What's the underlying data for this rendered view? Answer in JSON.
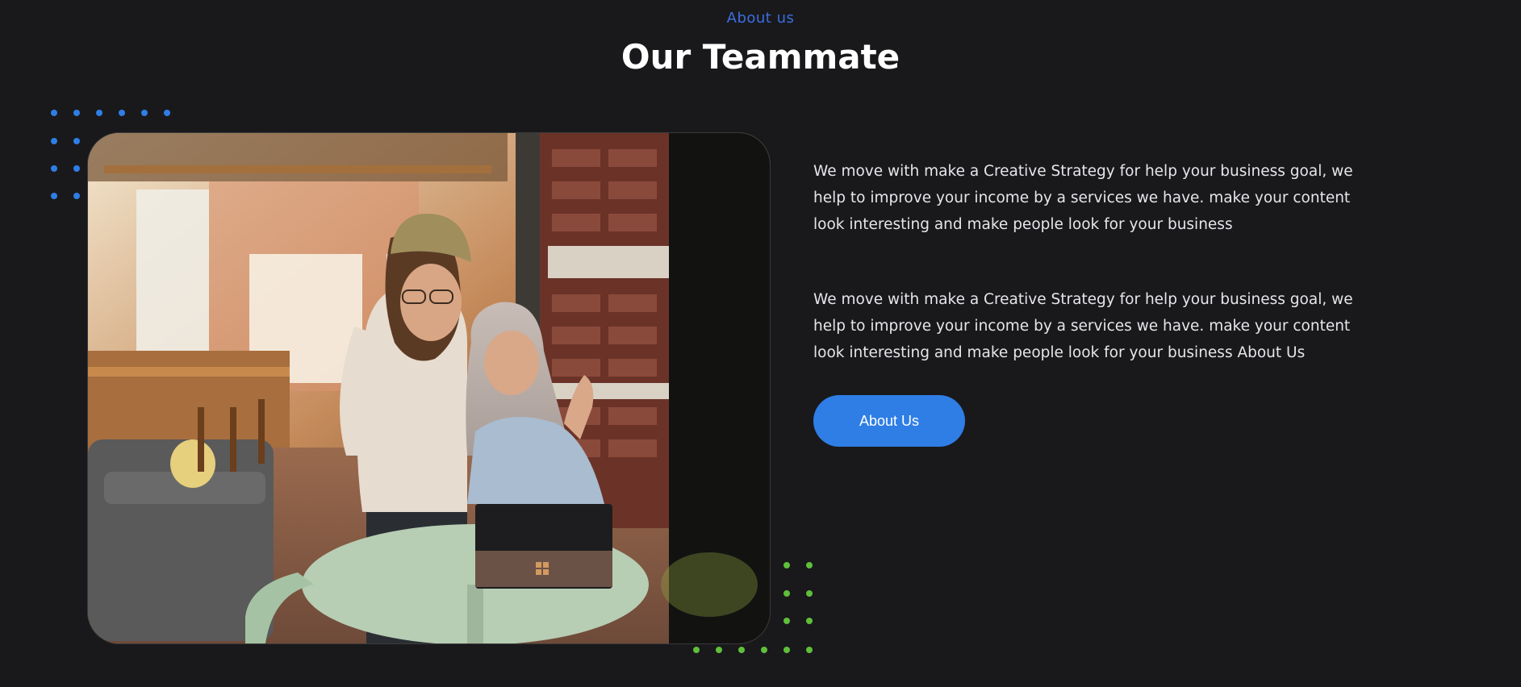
{
  "section": {
    "eyebrow": "About us",
    "title": "Our Teammate"
  },
  "content": {
    "paragraphs": [
      "We move with make a Creative Strategy for help your business goal, we help to improve your income by a services we have. make your content look interesting and make people look for your business",
      "We move with make a Creative Strategy for help your business goal, we help to improve your income by a services we have. make your content look interesting and make people look for your business About Us"
    ],
    "cta_label": "About Us"
  },
  "image": {
    "alt": "Two women waving at a laptop in a cafe"
  },
  "colors": {
    "background": "#19191c",
    "accent": "#2f7ee6",
    "eyebrow": "#3a6fe0",
    "dots_blue": "#2f7ee6",
    "dots_green": "#5fbf3a"
  }
}
